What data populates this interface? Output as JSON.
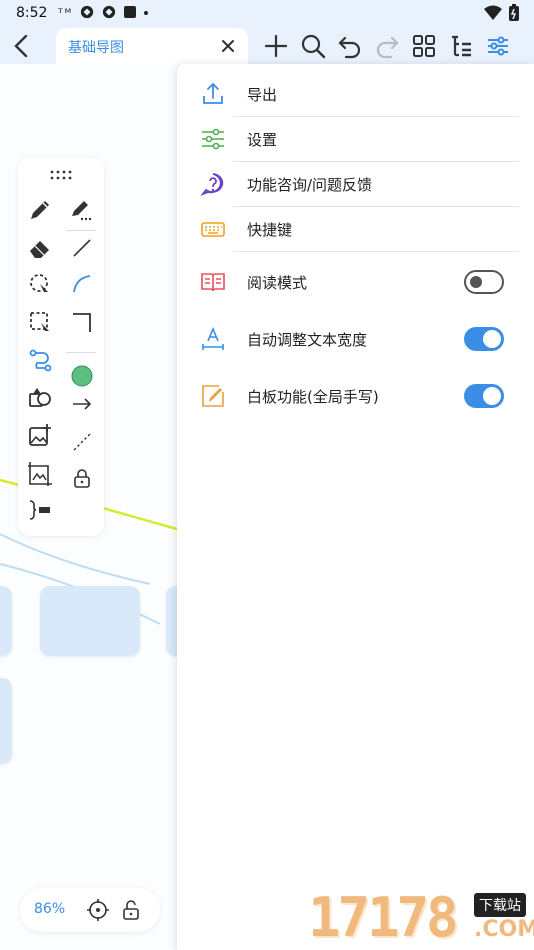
{
  "status_bar": {
    "time": "8:52",
    "carrier": "ᵀᴹ"
  },
  "tab": {
    "title": "基础导图",
    "close": "×"
  },
  "zoom": {
    "level": "86%"
  },
  "menu": {
    "items": [
      {
        "label": "导出",
        "icon": "export-icon"
      },
      {
        "label": "设置",
        "icon": "settings-sliders-icon"
      },
      {
        "label": "功能咨询/问题反馈",
        "icon": "help-icon"
      },
      {
        "label": "快捷键",
        "icon": "keyboard-icon"
      },
      {
        "label": "阅读模式",
        "icon": "book-icon",
        "toggle": false
      },
      {
        "label": "自动调整文本宽度",
        "icon": "text-width-icon",
        "toggle": true
      },
      {
        "label": "白板功能(全局手写)",
        "icon": "whiteboard-pen-icon",
        "toggle": true
      }
    ]
  },
  "watermark": {
    "number": "17178",
    "badge": "下载站",
    "domain": ".COM"
  },
  "colors": {
    "accent": "#3a8ee6",
    "bar_bg": "#e8f1fc",
    "node_fill": "#d9e9fa",
    "green_dot": "#5cbf7f"
  }
}
